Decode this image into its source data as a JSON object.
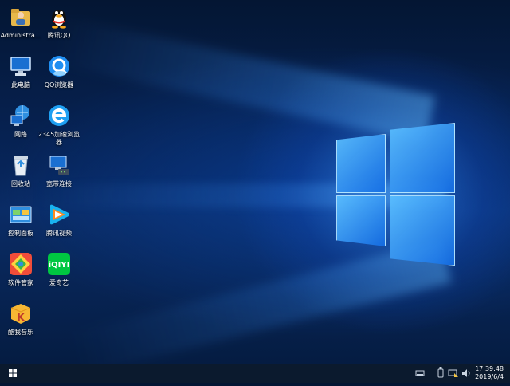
{
  "desktop": {
    "icons": [
      {
        "label": "Administra...",
        "icon": "user-folder-icon"
      },
      {
        "label": "腾讯QQ",
        "icon": "qq-penguin-icon"
      },
      {
        "label": "此电脑",
        "icon": "computer-icon"
      },
      {
        "label": "QQ浏览器",
        "icon": "qq-browser-icon"
      },
      {
        "label": "网络",
        "icon": "network-icon"
      },
      {
        "label": "2345加速浏览器",
        "icon": "ie-browser-icon"
      },
      {
        "label": "回收站",
        "icon": "recycle-bin-icon"
      },
      {
        "label": "宽带连接",
        "icon": "broadband-icon"
      },
      {
        "label": "控制面板",
        "icon": "control-panel-icon"
      },
      {
        "label": "腾讯视频",
        "icon": "tencent-video-icon"
      },
      {
        "label": "软件管家",
        "icon": "software-manager-icon"
      },
      {
        "label": "爱奇艺",
        "icon": "iqiyi-icon"
      },
      {
        "label": "酷我音乐",
        "icon": "kuwo-music-icon"
      }
    ]
  },
  "taskbar": {
    "time": "17:39:48",
    "date": "2019/6/4",
    "tray_icons": [
      "action-center-icon",
      "usb-icon",
      "network-tray-icon",
      "volume-icon"
    ]
  },
  "colors": {
    "taskbar_bg": "#0b1a2e",
    "accent": "#1e90ff"
  }
}
